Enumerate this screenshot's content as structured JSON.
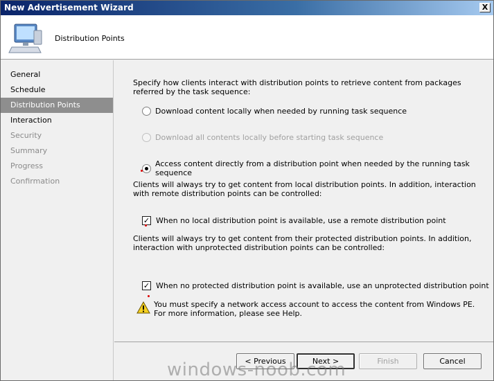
{
  "window": {
    "title": "New Advertisement Wizard",
    "close_glyph": "X"
  },
  "header": {
    "title": "Distribution Points",
    "icon": "computer-icon"
  },
  "sidebar": {
    "items": [
      {
        "label": "General",
        "state": "enabled"
      },
      {
        "label": "Schedule",
        "state": "enabled"
      },
      {
        "label": "Distribution Points",
        "state": "active"
      },
      {
        "label": "Interaction",
        "state": "enabled"
      },
      {
        "label": "Security",
        "state": "disabled"
      },
      {
        "label": "Summary",
        "state": "disabled"
      },
      {
        "label": "Progress",
        "state": "disabled"
      },
      {
        "label": "Confirmation",
        "state": "disabled"
      }
    ]
  },
  "main": {
    "intro": "Specify how clients interact with distribution points to retrieve content from packages referred by the task sequence:",
    "radio_download_locally": {
      "label": "Download content locally when needed by running task sequence",
      "checked": false,
      "enabled": true
    },
    "radio_download_all": {
      "label": "Download all contents locally before starting task sequence",
      "checked": false,
      "enabled": false
    },
    "radio_access_directly": {
      "label": "Access content directly from a distribution point when needed by the running task sequence",
      "checked": true,
      "enabled": true
    },
    "remote_info": "Clients will always try to get content from local distribution points. In addition, interaction with remote distribution points can be controlled:",
    "check_remote": {
      "label": "When no local distribution point is available, use a remote distribution point",
      "checked": true
    },
    "protected_info": "Clients will always try to get content from their protected distribution points. In addition, interaction with unprotected distribution points can be controlled:",
    "check_unprotected": {
      "label": "When no protected distribution point is available, use an unprotected distribution point",
      "checked": true
    },
    "warning": {
      "icon": "warning-icon",
      "text": "You must specify a network access account to access the content from Windows PE.  For more information, please see Help."
    }
  },
  "footer": {
    "previous_label": "< Previous",
    "next_label": "Next >",
    "finish_label": "Finish",
    "cancel_label": "Cancel"
  },
  "watermark": "windows-noob.com",
  "colors": {
    "titlebar": "#0a246a",
    "active_nav": "#8e8e8e",
    "window_bg": "#f0f0f0",
    "warning_yellow": "#f5d020",
    "marker_red": "#d00000"
  }
}
